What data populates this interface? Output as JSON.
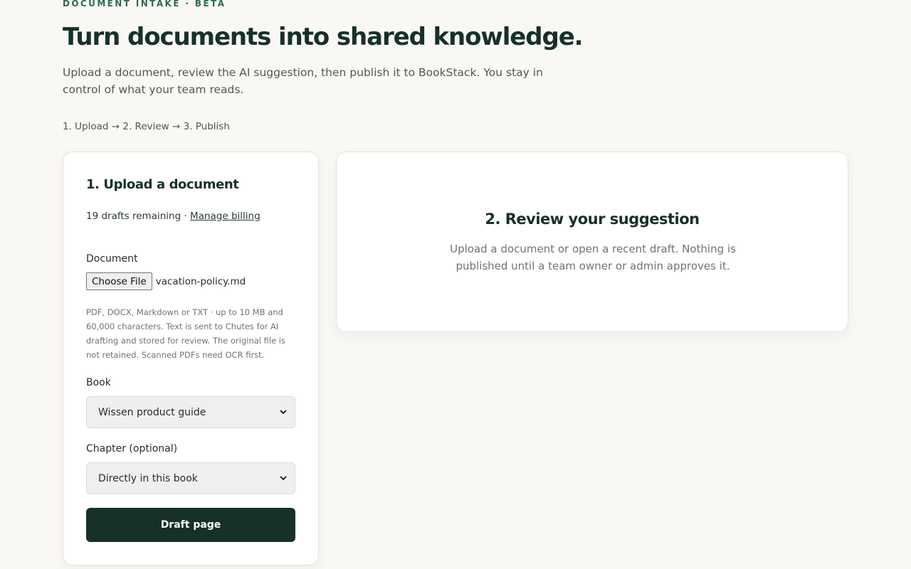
{
  "header": {
    "eyebrow": "DOCUMENT INTAKE · BETA",
    "title": "Turn documents into shared knowledge.",
    "subtitle": "Upload a document, review the AI suggestion, then publish it to BookStack. You stay in control of what your team reads.",
    "steps": "1. Upload → 2. Review → 3. Publish"
  },
  "upload": {
    "title": "1. Upload a document",
    "credits_text": "19 drafts remaining · ",
    "billing_link": "Manage billing",
    "document_label": "Document",
    "choose_file_label": "Choose File",
    "file_name": "vacation-policy.md",
    "help_text": "PDF, DOCX, Markdown or TXT · up to 10 MB and 60,000 characters. Text is sent to Chutes for AI drafting and stored for review. The original file is not retained. Scanned PDFs need OCR first.",
    "book_label": "Book",
    "book_selected": "Wissen product guide",
    "chapter_label": "Chapter (optional)",
    "chapter_selected": "Directly in this book",
    "submit_label": "Draft page"
  },
  "review": {
    "title": "2. Review your suggestion",
    "empty_text": "Upload a document or open a recent draft. Nothing is published until a team owner or admin approves it."
  },
  "icons": {
    "select_chevron": "chevron-down-icon"
  },
  "colors": {
    "background": "#faf8f5",
    "accent": "#2f6b52",
    "primary_button": "#17302a"
  }
}
